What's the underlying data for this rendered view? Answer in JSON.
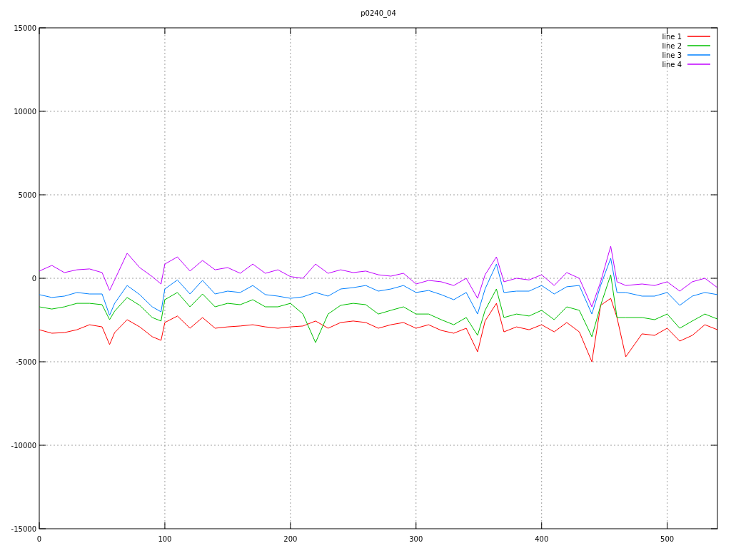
{
  "chart": {
    "chart_data": {
      "type": "line",
      "title": "p0240_04",
      "x": [
        0,
        10,
        20,
        30,
        40,
        50,
        56,
        60,
        70,
        80,
        90,
        97,
        100,
        110,
        120,
        130,
        140,
        150,
        160,
        170,
        180,
        190,
        200,
        210,
        220,
        230,
        240,
        250,
        260,
        270,
        280,
        290,
        300,
        310,
        320,
        330,
        340,
        349,
        355,
        364,
        370,
        380,
        390,
        400,
        410,
        420,
        430,
        440,
        447,
        455,
        460,
        467,
        480,
        490,
        500,
        510,
        520,
        530,
        540
      ],
      "series": [
        {
          "name": "line 1",
          "color": "#ff0000",
          "values": [
            -3080,
            -3290,
            -3250,
            -3080,
            -2780,
            -2910,
            -3970,
            -3250,
            -2480,
            -2910,
            -3500,
            -3720,
            -2650,
            -2260,
            -2990,
            -2350,
            -2990,
            -2910,
            -2860,
            -2780,
            -2910,
            -2990,
            -2910,
            -2860,
            -2560,
            -2990,
            -2650,
            -2560,
            -2650,
            -2990,
            -2780,
            -2650,
            -2990,
            -2780,
            -3120,
            -3290,
            -2990,
            -4400,
            -2560,
            -1500,
            -3210,
            -2910,
            -3080,
            -2780,
            -3210,
            -2650,
            -3210,
            -5000,
            -1620,
            -1200,
            -2350,
            -4700,
            -3330,
            -3420,
            -2990,
            -3760,
            -3420,
            -2780,
            -3080
          ]
        },
        {
          "name": "line 2",
          "color": "#00c000",
          "values": [
            -1710,
            -1840,
            -1710,
            -1500,
            -1500,
            -1580,
            -2480,
            -1970,
            -1150,
            -1620,
            -2350,
            -2560,
            -1280,
            -850,
            -1710,
            -940,
            -1710,
            -1500,
            -1580,
            -1280,
            -1710,
            -1710,
            -1500,
            -2140,
            -3850,
            -2140,
            -1620,
            -1500,
            -1580,
            -2140,
            -1920,
            -1710,
            -2140,
            -2140,
            -2480,
            -2780,
            -2350,
            -3420,
            -1920,
            -640,
            -2350,
            -2140,
            -2260,
            -1920,
            -2480,
            -1710,
            -1920,
            -3500,
            -1620,
            210,
            -2350,
            -2350,
            -2350,
            -2480,
            -2140,
            -2990,
            -2560,
            -2140,
            -2440
          ]
        },
        {
          "name": "line 3",
          "color": "#0080ff",
          "values": [
            -980,
            -1150,
            -1070,
            -850,
            -940,
            -940,
            -2220,
            -1500,
            -430,
            -980,
            -1710,
            -2010,
            -640,
            -100,
            -940,
            -130,
            -940,
            -770,
            -850,
            -430,
            -980,
            -1070,
            -1200,
            -1110,
            -850,
            -1070,
            -640,
            -560,
            -430,
            -770,
            -640,
            -430,
            -850,
            -730,
            -980,
            -1280,
            -850,
            -2140,
            -640,
            850,
            -850,
            -770,
            -770,
            -430,
            -940,
            -510,
            -430,
            -2140,
            -430,
            1200,
            -850,
            -850,
            -1070,
            -1070,
            -850,
            -1620,
            -1070,
            -850,
            -980
          ]
        },
        {
          "name": "line 4",
          "color": "#c000ff",
          "values": [
            430,
            770,
            340,
            510,
            560,
            340,
            -730,
            -100,
            1500,
            640,
            100,
            -340,
            850,
            1280,
            430,
            1070,
            510,
            640,
            300,
            850,
            300,
            510,
            100,
            0,
            850,
            300,
            510,
            340,
            430,
            210,
            130,
            300,
            -340,
            -130,
            -210,
            -430,
            0,
            -1200,
            210,
            1280,
            -210,
            0,
            -100,
            210,
            -430,
            340,
            0,
            -1710,
            -210,
            1920,
            -210,
            -430,
            -340,
            -430,
            -210,
            -770,
            -210,
            0,
            -560
          ]
        }
      ],
      "xlim": [
        0,
        540
      ],
      "ylim": [
        -15000,
        15000
      ],
      "xticks": [
        0,
        100,
        200,
        300,
        400,
        500
      ],
      "yticks": [
        -15000,
        -10000,
        -5000,
        0,
        5000,
        10000,
        15000
      ],
      "grid": true,
      "legend": true
    }
  }
}
